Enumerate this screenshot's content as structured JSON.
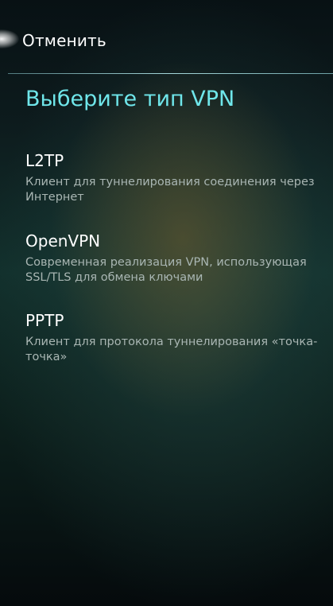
{
  "header": {
    "cancel_label": "Отменить"
  },
  "page": {
    "title": "Выберите тип VPN"
  },
  "vpn_types": [
    {
      "name": "L2TP",
      "description": "Клиент для туннелирования соединения через Интернет"
    },
    {
      "name": "OpenVPN",
      "description": "Современная реализация VPN, использующая SSL/TLS для обмена ключами"
    },
    {
      "name": "PPTP",
      "description": "Клиент для протокола туннелирования «точка-точка»"
    }
  ],
  "colors": {
    "accent": "#6fe6ea",
    "description_text": "#a9b6b3",
    "text": "#ffffff"
  }
}
